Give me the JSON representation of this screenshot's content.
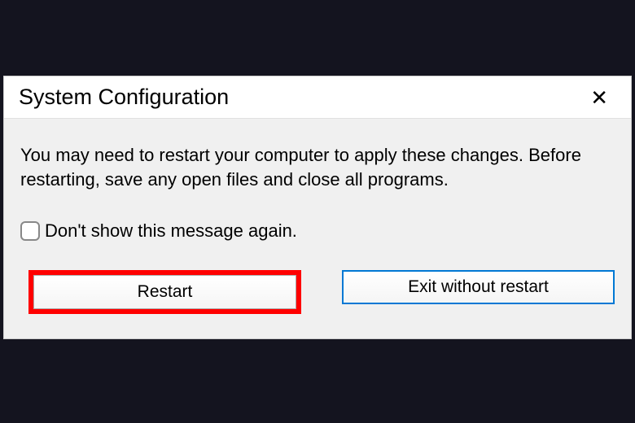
{
  "dialog": {
    "title": "System Configuration",
    "message": "You may need to restart your computer to apply these changes. Before restarting, save any open files and close all programs.",
    "checkbox_label": "Don't show this message again.",
    "restart_label": "Restart",
    "exit_label": "Exit without restart"
  }
}
